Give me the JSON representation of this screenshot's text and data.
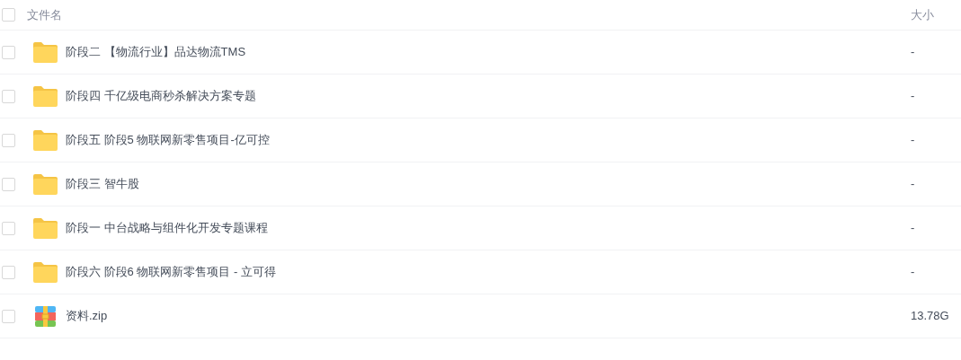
{
  "header": {
    "checked": false,
    "columns": [
      "文件名",
      "大小"
    ]
  },
  "files": [
    {
      "kind": "folder",
      "name": "阶段二 【物流行业】品达物流TMS",
      "size": "-",
      "checked": false
    },
    {
      "kind": "folder",
      "name": "阶段四 千亿级电商秒杀解决方案专题",
      "size": "-",
      "checked": false
    },
    {
      "kind": "folder",
      "name": "阶段五 阶段5 物联网新零售项目-亿可控",
      "size": "-",
      "checked": false
    },
    {
      "kind": "folder",
      "name": "阶段三 智牛股",
      "size": "-",
      "checked": false
    },
    {
      "kind": "folder",
      "name": "阶段一 中台战略与组件化开发专题课程",
      "size": "-",
      "checked": false
    },
    {
      "kind": "folder",
      "name": "阶段六 阶段6 物联网新零售项目 - 立可得",
      "size": "-",
      "checked": false
    },
    {
      "kind": "zip",
      "name": "资料.zip",
      "size": "13.78G",
      "checked": false
    }
  ]
}
